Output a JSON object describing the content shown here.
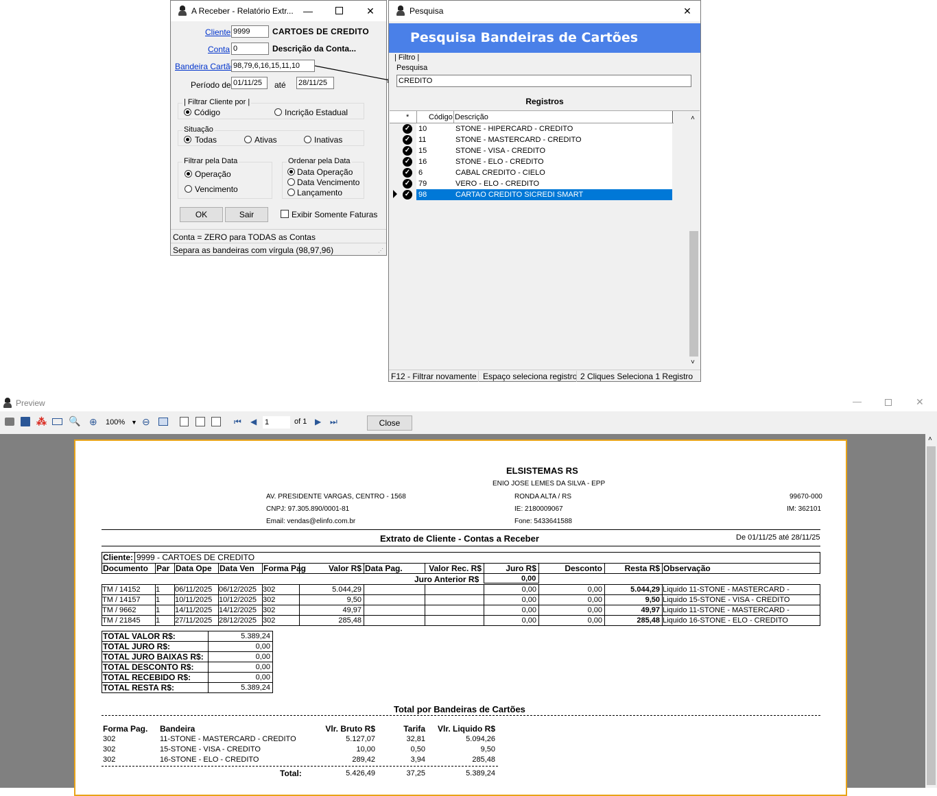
{
  "receber_window": {
    "title": "A Receber - Relatório Extr...",
    "cliente_label": "Cliente",
    "cliente_value": "9999",
    "cliente_name": "CARTOES DE CREDITO",
    "conta_label": "Conta",
    "conta_value": "0",
    "conta_desc": "Descrição da Conta...",
    "bandeira_label": "Bandeira Cartão",
    "bandeira_value": "98,79,6,16,15,11,10",
    "periodo_label": "Período de",
    "periodo_de": "01/11/25",
    "ate_label": "até",
    "periodo_ate": "28/11/25",
    "filtrar_cliente_caption": "Filtrar Cliente por",
    "filtrar_cliente_opts": [
      "Código",
      "Incrição Estadual"
    ],
    "situacao_caption": "Situação",
    "situacao_opts": [
      "Todas",
      "Ativas",
      "Inativas"
    ],
    "filtrar_data_caption": "Filtrar pela Data",
    "filtrar_data_opts": [
      "Operação",
      "Vencimento"
    ],
    "ordenar_caption": "Ordenar pela Data",
    "ordenar_opts": [
      "Data Operação",
      "Data Vencimento",
      "Lançamento"
    ],
    "ok_label": "OK",
    "sair_label": "Sair",
    "exibir_label": "Exibir Somente Faturas",
    "status1": "Conta = ZERO para TODAS as Contas",
    "status2": "Separa as bandeiras com vírgula (98,97,96)"
  },
  "pesquisa_window": {
    "title": "Pesquisa",
    "header": "Pesquisa Bandeiras de Cartões",
    "filtro_caption": "Filtro",
    "pesquisa_label": "Pesquisa",
    "pesquisa_value": "CREDITO",
    "registros_label": "Registros",
    "col_star": "*",
    "col_codigo": "Código",
    "col_descricao": "Descrição",
    "rows": [
      {
        "codigo": "10",
        "descricao": "STONE - HIPERCARD - CREDITO"
      },
      {
        "codigo": "11",
        "descricao": "STONE - MASTERCARD - CREDITO"
      },
      {
        "codigo": "15",
        "descricao": "STONE - VISA - CREDITO"
      },
      {
        "codigo": "16",
        "descricao": "STONE - ELO - CREDITO"
      },
      {
        "codigo": "6",
        "descricao": "CABAL CREDITO - CIELO"
      },
      {
        "codigo": "79",
        "descricao": "VERO - ELO - CREDITO"
      },
      {
        "codigo": "98",
        "descricao": "CARTAO CREDITO SICREDI SMART"
      }
    ],
    "status": [
      "F12 - Filtrar novamente",
      "Espaço seleciona registro",
      "2 Cliques Seleciona 1 Registro"
    ]
  },
  "preview": {
    "title": "Preview",
    "zoom": "100%",
    "page": "1",
    "of_label": "of 1",
    "close_label": "Close"
  },
  "report": {
    "company": "ELSISTEMAS RS",
    "owner": "ENIO JOSE LEMES DA SILVA - EPP",
    "address": "AV. PRESIDENTE VARGAS, CENTRO - 1568",
    "city": "RONDA ALTA / RS",
    "cep": "99670-000",
    "cnpj": "CNPJ: 97.305.890/0001-81",
    "ie": "IE: 2180009067",
    "im": "IM: 362101",
    "email": "Email: vendas@elinfo.com.br",
    "fone": "Fone: 5433641588",
    "report_title": "Extrato de Cliente - Contas a Receber",
    "period": "De 01/11/25 até 28/11/25",
    "cliente_label": "Cliente:",
    "cliente_value": "9999 - CARTOES DE CREDITO",
    "headers": [
      "Documento",
      "Par",
      "Data Ope",
      "Data Ven",
      "Forma Pag",
      "Valor R$",
      "Data Pag.",
      "Valor Rec. R$",
      "Juro R$",
      "Desconto",
      "Resta R$",
      "Observação"
    ],
    "juro_anterior_label": "Juro Anterior R$",
    "juro_anterior_value": "0,00",
    "rows": [
      {
        "doc": "TM / 14152",
        "par": "1",
        "ope": "06/11/2025",
        "ven": "06/12/2025",
        "forma": "302",
        "valor": "5.044,29",
        "juro": "0,00",
        "desc": "0,00",
        "resta": "5.044,29",
        "obs": "Liquido 11-STONE - MASTERCARD -"
      },
      {
        "doc": "TM / 14157",
        "par": "1",
        "ope": "10/11/2025",
        "ven": "10/12/2025",
        "forma": "302",
        "valor": "9,50",
        "juro": "0,00",
        "desc": "0,00",
        "resta": "9,50",
        "obs": "Liquido 15-STONE - VISA - CREDITO"
      },
      {
        "doc": "TM / 9662",
        "par": "1",
        "ope": "14/11/2025",
        "ven": "14/12/2025",
        "forma": "302",
        "valor": "49,97",
        "juro": "0,00",
        "desc": "0,00",
        "resta": "49,97",
        "obs": "Liquido 11-STONE - MASTERCARD -"
      },
      {
        "doc": "TM / 21845",
        "par": "1",
        "ope": "27/11/2025",
        "ven": "28/12/2025",
        "forma": "302",
        "valor": "285,48",
        "juro": "0,00",
        "desc": "0,00",
        "resta": "285,48",
        "obs": "Liquido 16-STONE - ELO - CREDITO"
      }
    ],
    "totals": [
      {
        "label": "TOTAL VALOR R$:",
        "value": "5.389,24"
      },
      {
        "label": "TOTAL JURO   R$:",
        "value": "0,00"
      },
      {
        "label": "TOTAL JURO BAIXAS R$:",
        "value": "0,00"
      },
      {
        "label": "TOTAL DESCONTO R$:",
        "value": "0,00"
      },
      {
        "label": "TOTAL RECEBIDO R$:",
        "value": "0,00"
      },
      {
        "label": "TOTAL RESTA R$:",
        "value": "5.389,24"
      }
    ],
    "bandeiras_title": "Total por Bandeiras de Cartões",
    "band_headers": [
      "Forma Pag.",
      "Bandeira",
      "Vlr. Bruto R$",
      "Tarifa",
      "Vlr. Liquido R$"
    ],
    "band_rows": [
      {
        "forma": "302",
        "bandeira": "11-STONE - MASTERCARD - CREDITO",
        "bruto": "5.127,07",
        "tarifa": "32,81",
        "liquido": "5.094,26"
      },
      {
        "forma": "302",
        "bandeira": "15-STONE - VISA - CREDITO",
        "bruto": "10,00",
        "tarifa": "0,50",
        "liquido": "9,50"
      },
      {
        "forma": "302",
        "bandeira": "16-STONE - ELO - CREDITO",
        "bruto": "289,42",
        "tarifa": "3,94",
        "liquido": "285,48"
      }
    ],
    "band_total_label": "Total:",
    "band_total_bruto": "5.426,49",
    "band_total_tarifa": "37,25",
    "band_total_liquido": "5.389,24"
  }
}
